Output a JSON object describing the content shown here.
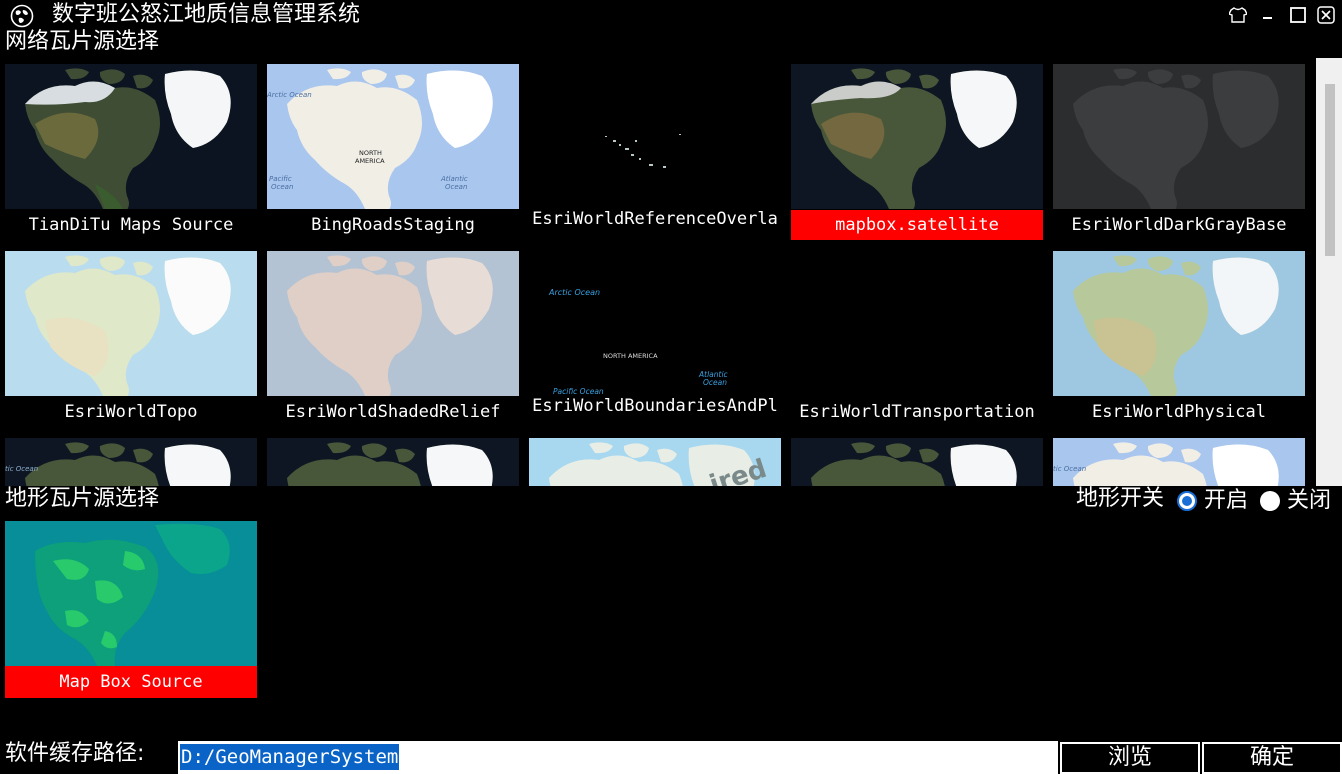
{
  "window": {
    "title": "数字班公怒江地质信息管理系统",
    "icon": "globe-icon",
    "controls": [
      "skin-icon",
      "minimize-icon",
      "maximize-icon",
      "close-icon"
    ]
  },
  "online_tiles": {
    "section_title": "网络瓦片源选择",
    "selected": "mapbox.satellite",
    "items": [
      {
        "label": "TianDiTu Maps Source",
        "thumb": "satellite"
      },
      {
        "label": "BingRoadsStaging",
        "thumb": "road"
      },
      {
        "label": "EsriWorldReferenceOverla",
        "thumb": "dark-overlay"
      },
      {
        "label": "mapbox.satellite",
        "thumb": "satellite"
      },
      {
        "label": "EsriWorldDarkGrayBase",
        "thumb": "dark-gray"
      },
      {
        "label": "EsriWorldTopo",
        "thumb": "topo"
      },
      {
        "label": "EsriWorldShadedRelief",
        "thumb": "shaded"
      },
      {
        "label": "EsriWorldBoundariesAndPl",
        "thumb": "boundaries"
      },
      {
        "label": "EsriWorldTransportation",
        "thumb": "blank"
      },
      {
        "label": "EsriWorldPhysical",
        "thumb": "physical"
      }
    ],
    "partial_row_thumbs": [
      "satellite",
      "satellite",
      "retired",
      "satellite",
      "road"
    ],
    "map_labels": {
      "arctic_ocean": "Arctic Ocean",
      "pacific_ocean": "Pacific Ocean",
      "atlantic_ocean": "Atlantic Ocean",
      "north_america": "NORTH AMERICA",
      "retired_watermark": "ired"
    }
  },
  "terrain": {
    "section_title": "地形瓦片源选择",
    "switch_label": "地形开关",
    "on_label": "开启",
    "off_label": "关闭",
    "enabled": true,
    "item": {
      "label": "Map Box Source",
      "thumb": "terrain"
    }
  },
  "cache": {
    "label": "软件缓存路径:",
    "value": "D:/GeoManagerSystem",
    "browse_label": "浏览",
    "confirm_label": "确定"
  },
  "colors": {
    "background": "#000000",
    "selection": "#ff0000",
    "input_highlight": "#0a64c8",
    "radio_accent": "#1a6fd6"
  }
}
